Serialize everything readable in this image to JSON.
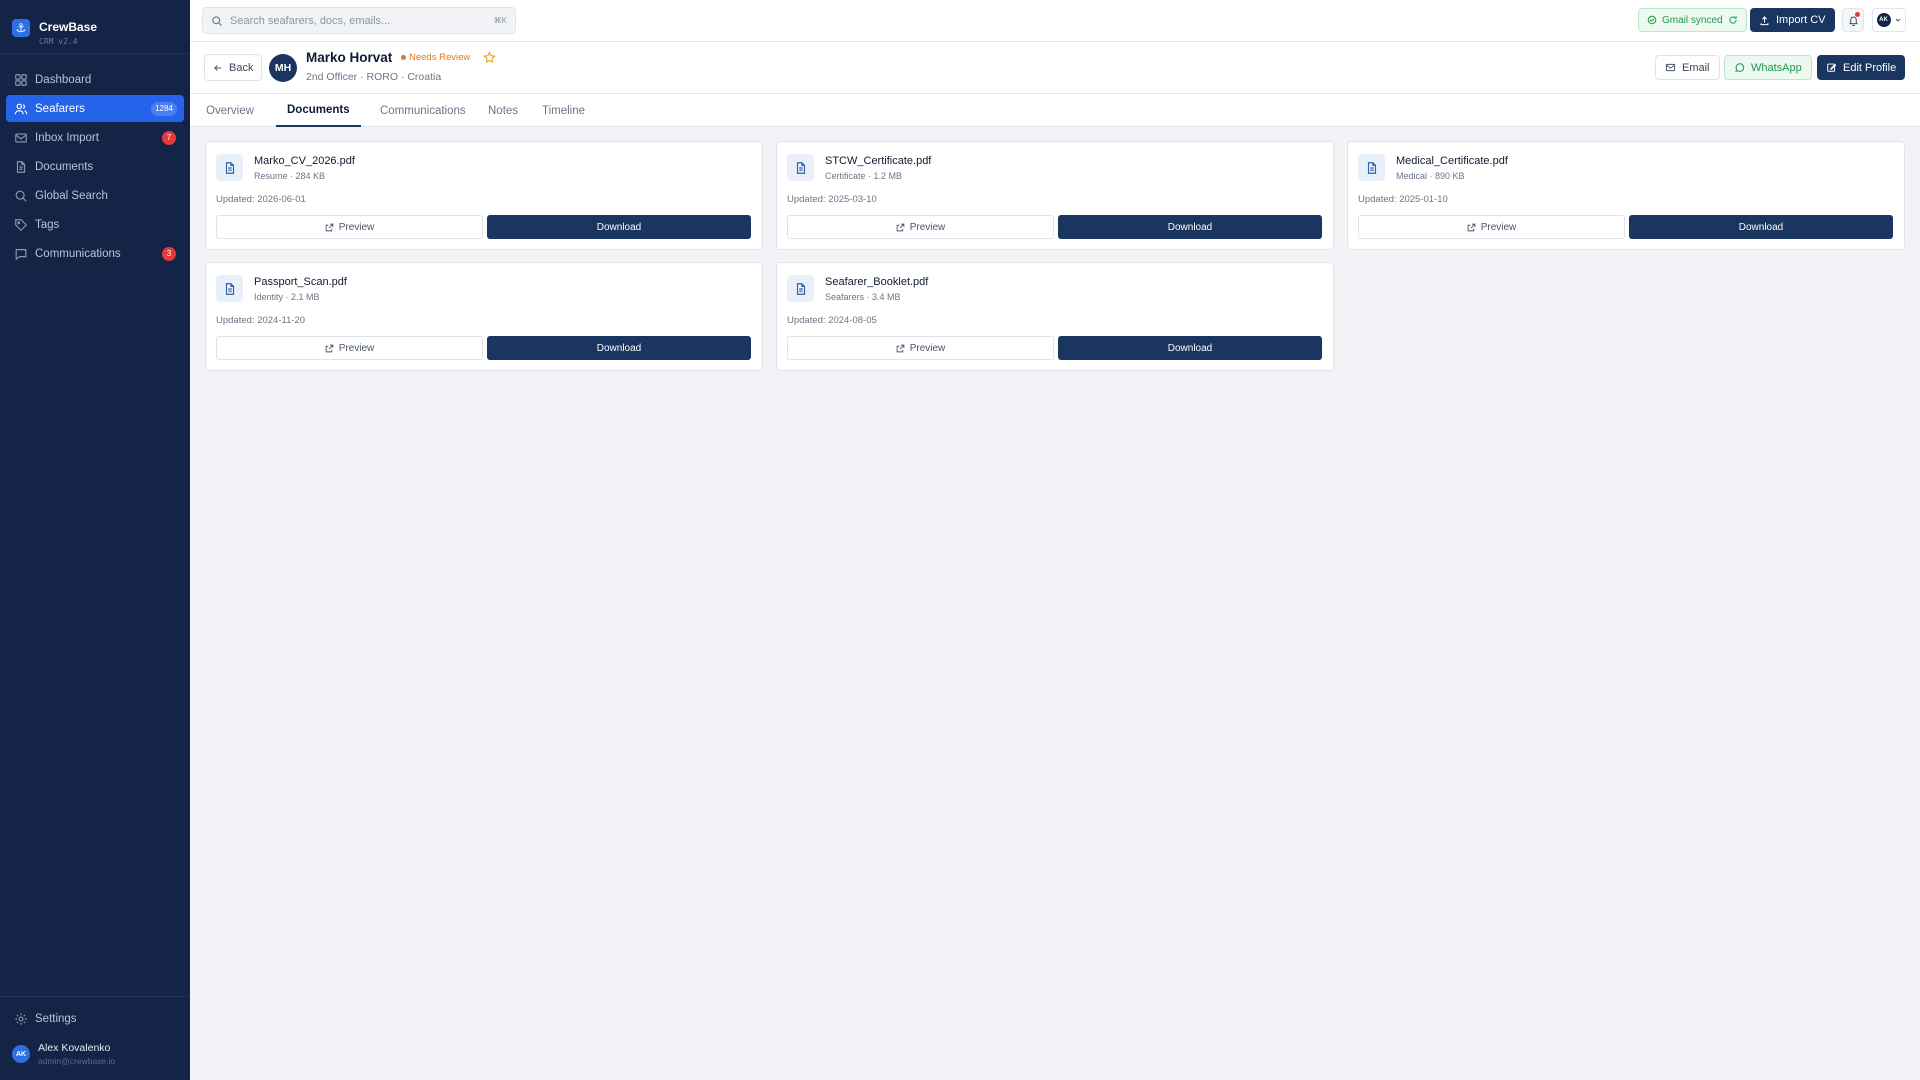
{
  "sidebar": {
    "brand_name": "CrewBase",
    "brand_version": "CRM v2.4",
    "items": [
      {
        "label": "Dashboard"
      },
      {
        "label": "Seafarers",
        "badge": "1284"
      },
      {
        "label": "Inbox Import",
        "badge": "7"
      },
      {
        "label": "Documents"
      },
      {
        "label": "Global Search"
      },
      {
        "label": "Tags"
      },
      {
        "label": "Communications",
        "badge": "3"
      }
    ],
    "settings_label": "Settings",
    "user": {
      "initials": "AK",
      "name": "Alex Kovalenko",
      "email": "admin@crewbase.io"
    }
  },
  "topbar": {
    "search_placeholder": "Search seafarers, docs, emails...",
    "search_shortcut": "⌘K",
    "gmail_status": "Gmail synced",
    "import_label": "Import CV",
    "account_initials": "AK"
  },
  "profile": {
    "back_label": "Back",
    "initials": "MH",
    "name": "Marko Horvat",
    "status": "Needs Review",
    "subtitle": "2nd Officer · RORO · Croatia",
    "email_label": "Email",
    "whatsapp_label": "WhatsApp",
    "edit_label": "Edit Profile"
  },
  "tabs": [
    {
      "label": "Overview"
    },
    {
      "label": "Documents"
    },
    {
      "label": "Communications"
    },
    {
      "label": "Notes"
    },
    {
      "label": "Timeline"
    }
  ],
  "documents": [
    {
      "name": "Marko_CV_2026.pdf",
      "meta": "Resume · 284 KB",
      "updated": "Updated: 2026-06-01",
      "preview": "Preview",
      "download": "Download"
    },
    {
      "name": "STCW_Certificate.pdf",
      "meta": "Certificate · 1.2 MB",
      "updated": "Updated: 2025-03-10",
      "preview": "Preview",
      "download": "Download"
    },
    {
      "name": "Medical_Certificate.pdf",
      "meta": "Medical · 890 KB",
      "updated": "Updated: 2025-01-10",
      "preview": "Preview",
      "download": "Download"
    },
    {
      "name": "Passport_Scan.pdf",
      "meta": "Identity · 2.1 MB",
      "updated": "Updated: 2024-11-20",
      "preview": "Preview",
      "download": "Download"
    },
    {
      "name": "Seafarer_Booklet.pdf",
      "meta": "Seafarers · 3.4 MB",
      "updated": "Updated: 2024-08-05",
      "preview": "Preview",
      "download": "Download"
    }
  ],
  "colors": {
    "sidebar_bg": "#142446",
    "accent": "#2563eb",
    "primary_button": "#1a3560",
    "warning": "#e07a1c",
    "success": "#1e9a4c",
    "alert_badge": "#e5383b"
  },
  "icons": {
    "nav": [
      "dashboard-icon",
      "users-icon",
      "mail-icon",
      "file-icon",
      "search-icon",
      "tag-icon",
      "message-icon"
    ],
    "settings": "gear-icon",
    "document": "document-icon"
  }
}
